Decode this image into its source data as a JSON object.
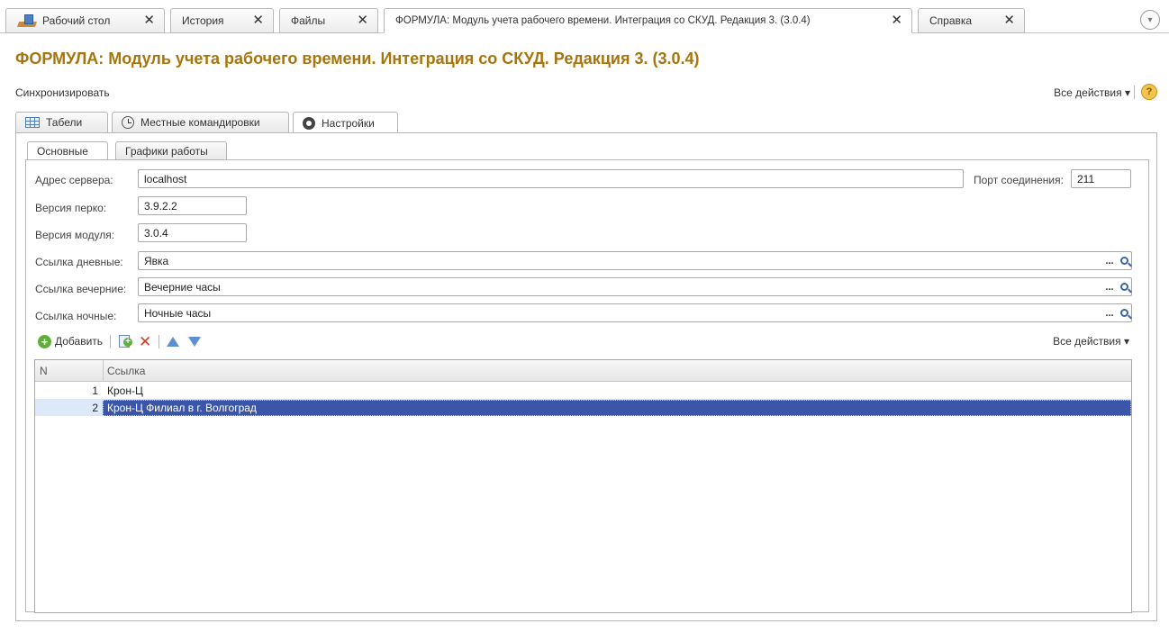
{
  "window_tabs": [
    {
      "label": "Рабочий стол",
      "close": "✕"
    },
    {
      "label": "История",
      "close": "✕"
    },
    {
      "label": "Файлы",
      "close": "✕"
    },
    {
      "label": "ФОРМУЛА: Модуль учета рабочего времени. Интеграция со СКУД. Редакция 3. (3.0.4)",
      "close": "✕"
    },
    {
      "label": "Справка",
      "close": "✕"
    }
  ],
  "menu_glyph": "▾",
  "title": "ФОРМУЛА: Модуль учета рабочего времени. Интеграция со СКУД. Редакция 3. (3.0.4)",
  "command_bar": {
    "sync": "Синхронизировать",
    "all_actions": "Все действия ▾",
    "help": "?"
  },
  "main_tabs": [
    {
      "label": "Табели",
      "icon": "table-icon"
    },
    {
      "label": "Местные командировки",
      "icon": "clock-icon"
    },
    {
      "label": "Настройки",
      "icon": "gear-icon"
    }
  ],
  "sub_tabs": [
    {
      "label": "Основные"
    },
    {
      "label": "Графики работы"
    }
  ],
  "form": {
    "server_label": "Адрес сервера:",
    "server_value": "localhost",
    "port_label": "Порт соединения:",
    "port_value": "211",
    "perco_label": "Версия перко:",
    "perco_value": "3.9.2.2",
    "module_label": "Версия модуля:",
    "module_value": "3.0.4",
    "day_label": "Ссылка дневные:",
    "day_value": "Явка",
    "evening_label": "Ссылка вечерние:",
    "evening_value": "Вечерние часы",
    "night_label": "Ссылка ночные:",
    "night_value": "Ночные часы",
    "pick_glyph": "..."
  },
  "list_toolbar": {
    "add": "Добавить",
    "delete_glyph": "✕",
    "all_actions": "Все действия ▾"
  },
  "table": {
    "columns": [
      "N",
      "Ссылка"
    ],
    "rows": [
      {
        "n": "1",
        "value": "Крон-Ц",
        "selected": false
      },
      {
        "n": "2",
        "value": "Крон-Ц  Филиал в г. Волгоград",
        "selected": true
      }
    ]
  },
  "colors": {
    "title": "#a8740c",
    "selection": "#3b56a8",
    "add_green": "#5cb03a",
    "delete_red": "#d23a2a"
  }
}
